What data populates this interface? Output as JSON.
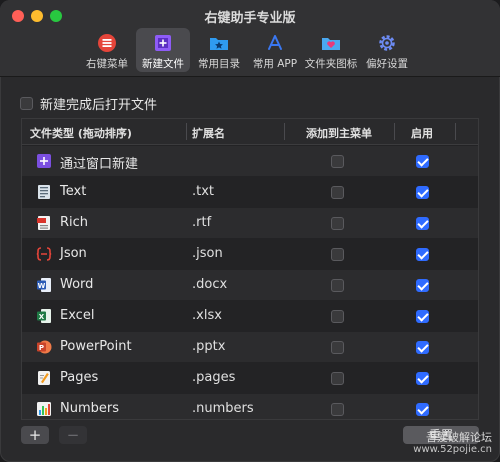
{
  "window": {
    "title": "右键助手专业版"
  },
  "toolbar": {
    "items": [
      {
        "label": "右键菜单",
        "icon": "list-icon"
      },
      {
        "label": "新建文件",
        "icon": "new-file-icon",
        "active": true
      },
      {
        "label": "常用目录",
        "icon": "folder-star-icon"
      },
      {
        "label": "常用 APP",
        "icon": "app-store-icon"
      },
      {
        "label": "文件夹图标",
        "icon": "folder-heart-icon"
      },
      {
        "label": "偏好设置",
        "icon": "gear-icon"
      }
    ]
  },
  "open_after_create": {
    "label": "新建完成后打开文件",
    "checked": false
  },
  "table": {
    "headers": {
      "type": "文件类型 (拖动排序)",
      "ext": "扩展名",
      "main_menu": "添加到主菜单",
      "enabled": "启用"
    },
    "rows": [
      {
        "name": "通过窗口新建",
        "ext": "",
        "main_menu": false,
        "enabled": true,
        "icon": "window-new-icon"
      },
      {
        "name": "Text",
        "ext": ".txt",
        "main_menu": false,
        "enabled": true,
        "icon": "text-doc-icon"
      },
      {
        "name": "Rich",
        "ext": ".rtf",
        "main_menu": false,
        "enabled": true,
        "icon": "rtf-doc-icon"
      },
      {
        "name": "Json",
        "ext": ".json",
        "main_menu": false,
        "enabled": true,
        "icon": "json-doc-icon"
      },
      {
        "name": "Word",
        "ext": ".docx",
        "main_menu": false,
        "enabled": true,
        "icon": "word-icon"
      },
      {
        "name": "Excel",
        "ext": ".xlsx",
        "main_menu": false,
        "enabled": true,
        "icon": "excel-icon"
      },
      {
        "name": "PowerPoint",
        "ext": ".pptx",
        "main_menu": false,
        "enabled": true,
        "icon": "powerpoint-icon"
      },
      {
        "name": "Pages",
        "ext": ".pages",
        "main_menu": false,
        "enabled": true,
        "icon": "pages-icon"
      },
      {
        "name": "Numbers",
        "ext": ".numbers",
        "main_menu": false,
        "enabled": true,
        "icon": "numbers-icon"
      }
    ]
  },
  "footer": {
    "add_label": "+",
    "remove_label": "−",
    "reset_label": "重置"
  },
  "watermark": {
    "line1": "吾爱破解论坛",
    "line2": "www.52pojie.cn"
  }
}
